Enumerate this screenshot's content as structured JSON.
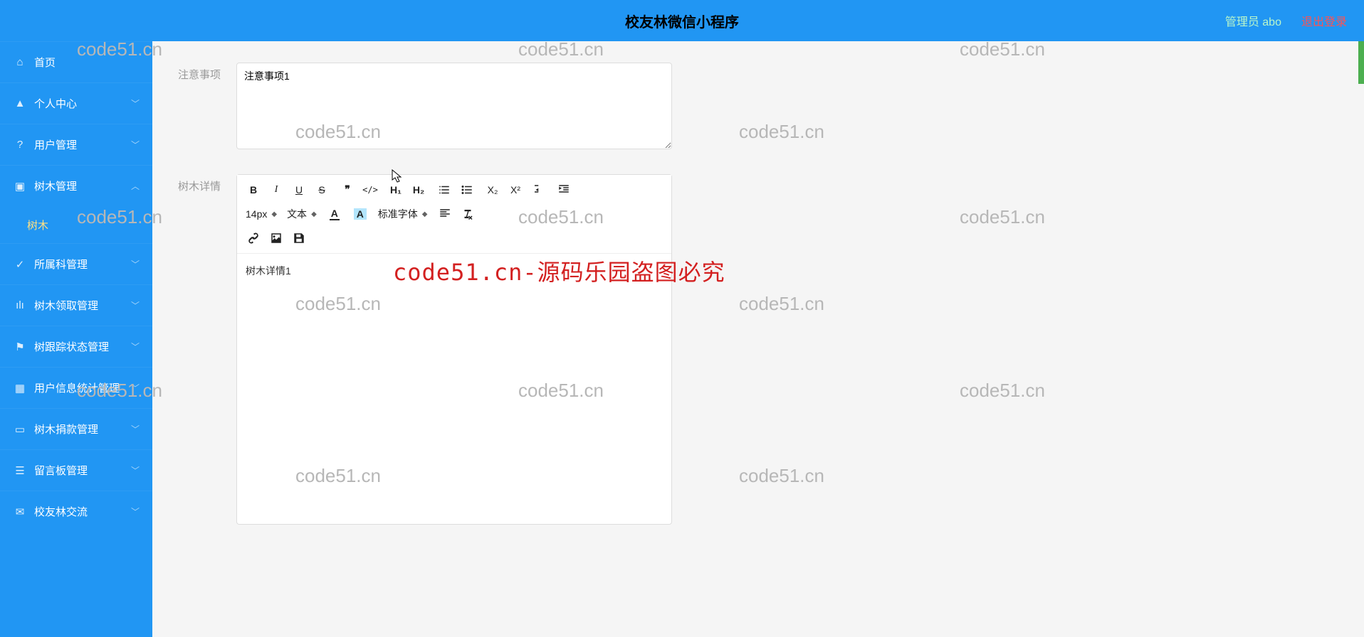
{
  "header": {
    "title": "校友林微信小程序",
    "admin": "管理员 abo",
    "logout": "退出登录"
  },
  "sidebar": {
    "items": [
      {
        "icon": "home",
        "label": "首页",
        "expandable": false
      },
      {
        "icon": "user",
        "label": "个人中心",
        "expandable": true
      },
      {
        "icon": "help",
        "label": "用户管理",
        "expandable": true
      },
      {
        "icon": "chat",
        "label": "树木管理",
        "expandable": true,
        "open": true,
        "children": [
          {
            "label": "树木"
          }
        ]
      },
      {
        "icon": "check",
        "label": "所属科管理",
        "expandable": true
      },
      {
        "icon": "bars",
        "label": "树木领取管理",
        "expandable": true
      },
      {
        "icon": "flag",
        "label": "树跟踪状态管理",
        "expandable": true
      },
      {
        "icon": "grid",
        "label": "用户信息统计管理",
        "expandable": true
      },
      {
        "icon": "screen",
        "label": "树木捐款管理",
        "expandable": true
      },
      {
        "icon": "note",
        "label": "留言板管理",
        "expandable": true
      },
      {
        "icon": "mail",
        "label": "校友林交流",
        "expandable": true
      }
    ]
  },
  "form": {
    "note_label": "注意事项",
    "note_value": "注意事项1",
    "detail_label": "树木详情",
    "detail_value": "树木详情1"
  },
  "editor": {
    "font_size": "14px",
    "style_label": "文本",
    "font_family": "标准字体",
    "h1": "H₁",
    "h2": "H₂",
    "sub": "X₂",
    "sup": "X²"
  },
  "watermarks": {
    "text": "code51.cn",
    "red": "code51.cn-源码乐园盗图必究"
  }
}
